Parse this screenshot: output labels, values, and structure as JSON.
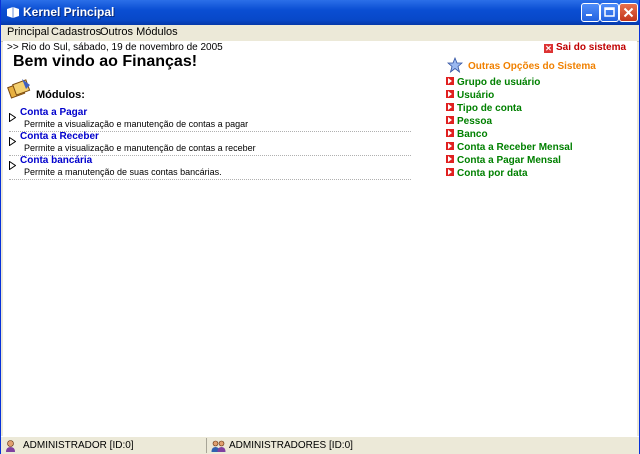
{
  "window": {
    "title": "Kernel Principal"
  },
  "menu": {
    "items": [
      "Principal",
      "Cadastros",
      "Outros Módulos"
    ]
  },
  "header": {
    "date_line": ">> Rio do Sul, sábado, 19 de novembro de 2005",
    "welcome": "Bem vindo ao Finanças!",
    "logout": "Sai do sistema"
  },
  "modules": {
    "title": "Módulos:",
    "items": [
      {
        "name": "Conta a Pagar",
        "description": "Permite a visualização e manutenção de contas a pagar"
      },
      {
        "name": "Conta a Receber",
        "description": "Permite a visualização e manutenção de contas a receber"
      },
      {
        "name": "Conta bancária",
        "description": "Permite a manutenção de suas contas bancárias."
      }
    ]
  },
  "sidebar": {
    "title": "Outras Opções do Sistema",
    "links": [
      "Grupo de usuário",
      "Usuário",
      "Tipo de conta",
      "Pessoa",
      "Banco",
      "Conta a Receber Mensal",
      "Conta a Pagar Mensal",
      "Conta por data"
    ]
  },
  "status": {
    "user": "ADMINISTRADOR [ID:0]",
    "group": "ADMINISTRADORES [ID:0]"
  },
  "colors": {
    "link_blue": "#0000cc",
    "option_green": "#008000",
    "heading_orange": "#f08000",
    "logout_red": "#c00000"
  }
}
